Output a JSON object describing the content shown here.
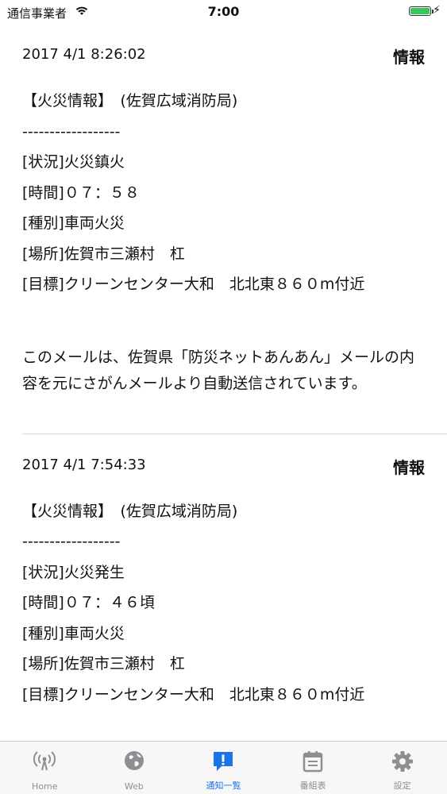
{
  "status_bar": {
    "carrier": "通信事業者",
    "time": "7:00",
    "battery_level": 1.0
  },
  "notices": [
    {
      "date": "2017 4/1 8:26:02",
      "kind": "情報",
      "lines": [
        "【火災情報】　(佐賀広域消防局)",
        "------------------",
        "[状況]火災鎮火",
        "[時間]０７：５８",
        "[種別]車両火災",
        "[場所]佐賀市三瀬村　杠",
        "[目標]クリーンセンター大和　北北東８６０m付近"
      ],
      "footer": "このメールは、佐賀県「防災ネットあんあん」メールの内容を元にさがんメールより自動送信されています。"
    },
    {
      "date": "2017 4/1 7:54:33",
      "kind": "情報",
      "lines": [
        "【火災情報】　(佐賀広域消防局)",
        "------------------",
        "[状況]火災発生",
        "[時間]０７：４６頃",
        "[種別]車両火災",
        "[場所]佐賀市三瀬村　杠",
        "[目標]クリーンセンター大和　北北東８６０m付近"
      ]
    }
  ],
  "tab_bar": {
    "active": "通知一覧",
    "tabs": [
      {
        "label": "Home",
        "icon": "antenna-icon"
      },
      {
        "label": "Web",
        "icon": "globe-icon"
      },
      {
        "label": "通知一覧",
        "icon": "notification-icon"
      },
      {
        "label": "番組表",
        "icon": "calendar-icon"
      },
      {
        "label": "設定",
        "icon": "gear-icon"
      }
    ]
  },
  "colors": {
    "accent": "#1a73e8",
    "inactive": "#8e8e93",
    "battery": "#35c759"
  }
}
